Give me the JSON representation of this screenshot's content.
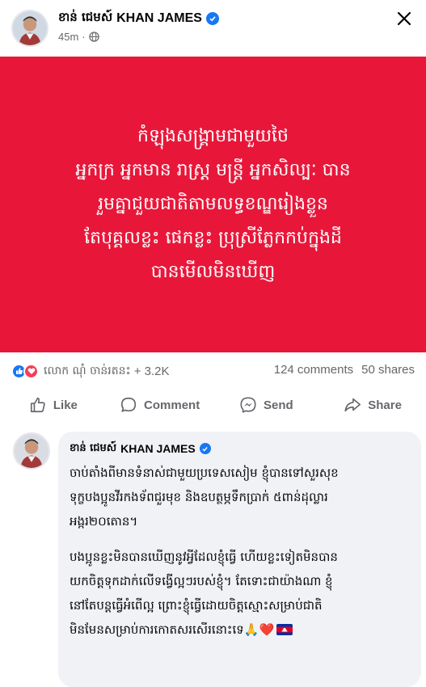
{
  "post": {
    "author_kh": "ខាន់ ជេមស៍",
    "author_en": "KHAN JAMES",
    "time": "45m",
    "banner_lines": [
      "កំឡុងសង្គ្រាមជាមួយថៃ",
      "អ្នកក្រ អ្នកមាន រាស្រ្ត មន្រ្តី អ្នកសិល្បៈ បាន",
      "រួមគ្នាជួយជាតិតាមលទ្ធខណ្ឌរៀងខ្លួន",
      "តែបុគ្គលខ្លះ ផេកខ្លះ ប្រុស្រីភ្លែកកប់ក្នុងដី",
      "បានមើលមិនឃើញ"
    ],
    "banner_color": "#e8173a"
  },
  "reactions": {
    "names": "លោក ណុំ ចាន់រតនះ",
    "count": "+ 3.2K",
    "comments": "124 comments",
    "shares": "50 shares"
  },
  "actions": {
    "like": "Like",
    "comment": "Comment",
    "send": "Send",
    "share": "Share"
  },
  "comment": {
    "author_kh": "ខាន់ ជេមស៍",
    "author_en": "KHAN JAMES",
    "para1_lines": [
      "ចាប់តាំងពីមានទំនាស់ជាមួយប្រទេសសៀម ខ្ញុំបានទៅសួរសុខ",
      "ទុក្ខបងប្អូនវីរកងទ័ពជួរមុខ និងឧបត្ថម្ភទឹកប្រាក់ ៥ពាន់ដុល្លារ",
      "អង្ករ២០តោន។"
    ],
    "para2_lines": [
      "បងប្អូនខ្លះមិនបានឃើញនូវអ្វីដែលខ្ញុំធ្វើ ហើយខ្លះទៀតមិនបាន",
      "យកចិត្តទុកដាក់លើទង្វើល្អៗរបស់ខ្ញុំ។ តែទោះជាយ៉ាងណា ខ្ញុំ",
      "នៅតែបន្តធ្វើអំពើល្អ ព្រោះខ្ញុំធ្វើដោយចិត្តស្មោះសម្រាប់ជាតិ",
      "មិនមែនសម្រាប់ការកោតសរសើរនោះទេ"
    ],
    "emoji": "🙏❤️"
  },
  "icons": {
    "verified": "verified-badge-icon",
    "globe": "globe-icon",
    "close": "close-icon",
    "flag": "cambodia-flag-icon"
  }
}
